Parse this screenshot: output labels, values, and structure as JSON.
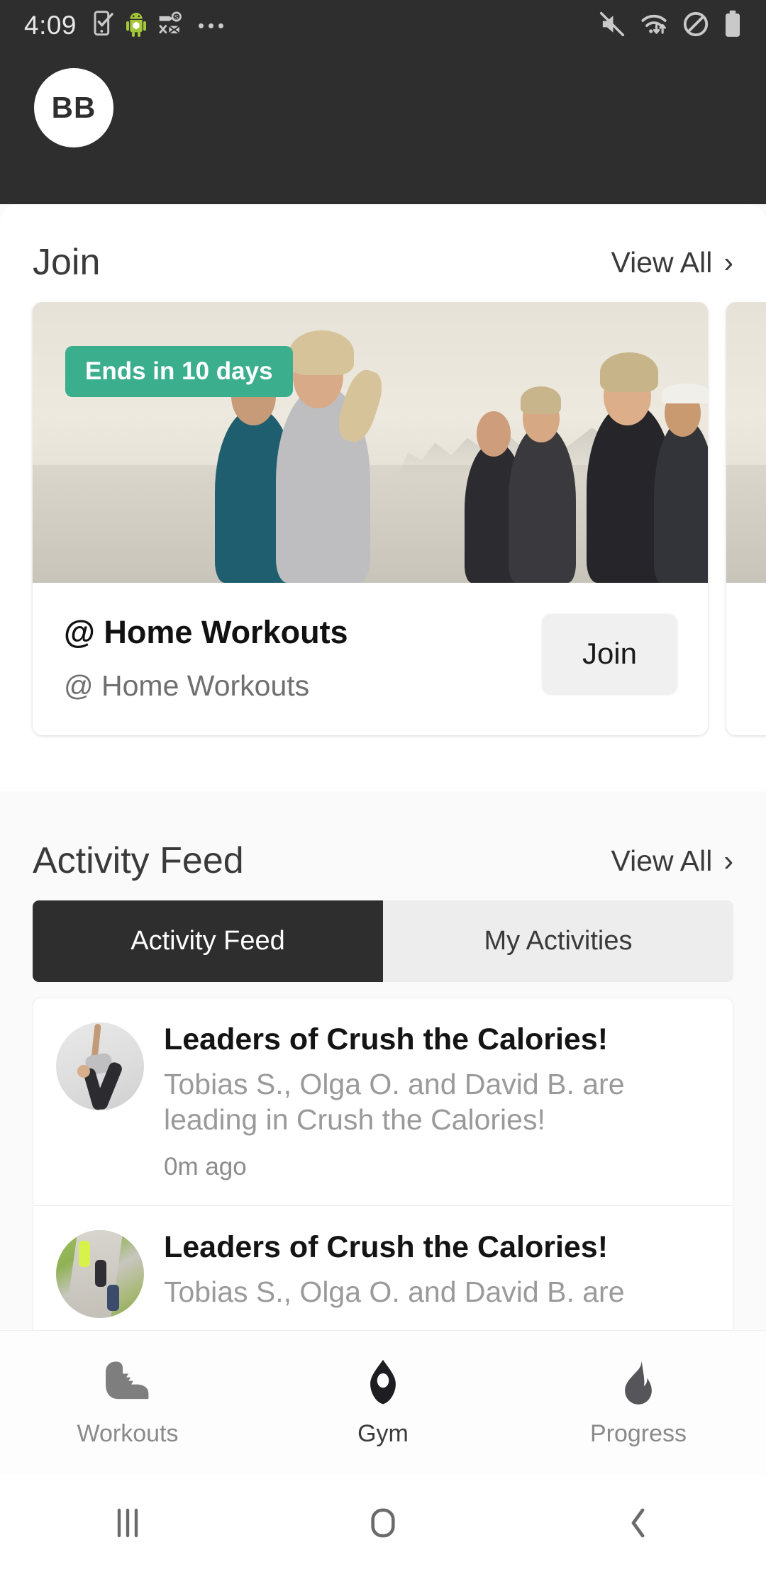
{
  "statusbar": {
    "time": "4:09",
    "left_icons": [
      "sim-check-icon",
      "android-robot-icon",
      "data-saver-off-icon",
      "more-notifications-icon"
    ],
    "right_icons": [
      "volume-muted-icon",
      "wifi-transfer-icon",
      "do-not-disturb-icon",
      "battery-full-icon"
    ]
  },
  "header": {
    "avatar_initials": "BB"
  },
  "join_section": {
    "title": "Join",
    "view_all": "View All",
    "cards": [
      {
        "badge": "Ends in 10 days",
        "title": "@ Home Workouts",
        "subtitle": "@ Home Workouts",
        "action": "Join"
      },
      {
        "badge": "",
        "title": "",
        "subtitle": "",
        "action": ""
      }
    ]
  },
  "activity_section": {
    "title": "Activity Feed",
    "view_all": "View All",
    "tabs": [
      {
        "label": "Activity Feed",
        "active": true
      },
      {
        "label": "My Activities",
        "active": false
      }
    ],
    "items": [
      {
        "avatar": "yoga-pose-photo",
        "title": "Leaders of Crush the Calories!",
        "description": "Tobias S., Olga O. and David B. are leading in Crush the Calories!",
        "time": "0m ago"
      },
      {
        "avatar": "runners-on-path-photo",
        "title": "Leaders of Crush the Calories!",
        "description": "Tobias S., Olga O. and David B. are",
        "time": ""
      }
    ]
  },
  "bottom_nav": [
    {
      "label": "Workouts",
      "icon": "shoe-icon",
      "active": false
    },
    {
      "label": "Gym",
      "icon": "gym-pin-icon",
      "active": true
    },
    {
      "label": "Progress",
      "icon": "flame-icon",
      "active": false
    }
  ],
  "android_nav": [
    {
      "icon": "recents-icon"
    },
    {
      "icon": "home-icon"
    },
    {
      "icon": "back-icon"
    }
  ],
  "colors": {
    "header_dark": "#2E2E2E",
    "badge_green": "#3BAE8E",
    "tab_active": "#2E2E2E",
    "tab_inactive": "#EDEDED",
    "page_bg": "#FAFAFA"
  }
}
